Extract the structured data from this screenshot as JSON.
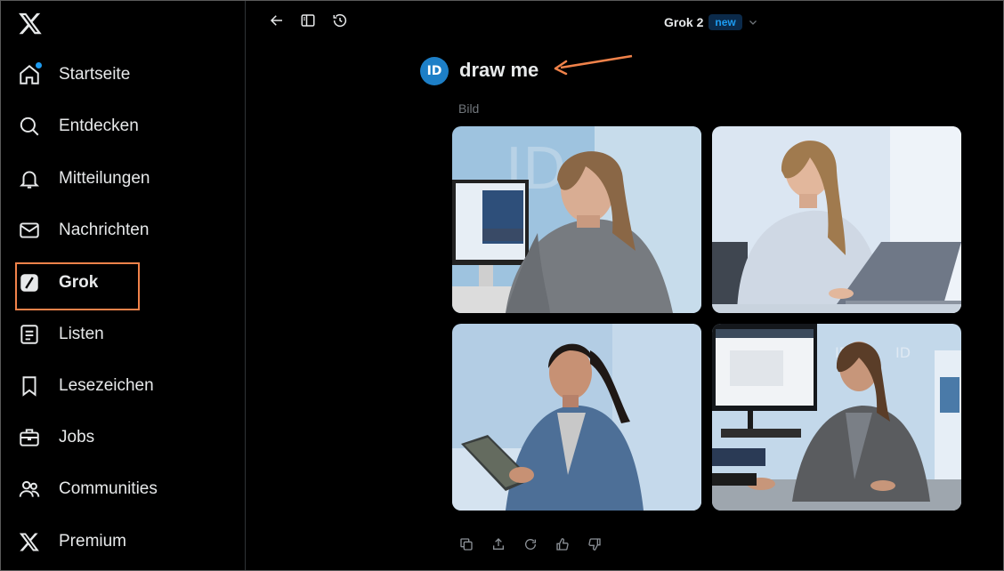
{
  "app": {
    "logo": "x-logo-icon"
  },
  "sidebar": {
    "items": [
      {
        "label": "Startseite",
        "icon": "home-icon",
        "has_dot": true
      },
      {
        "label": "Entdecken",
        "icon": "search-icon"
      },
      {
        "label": "Mitteilungen",
        "icon": "bell-icon"
      },
      {
        "label": "Nachrichten",
        "icon": "mail-icon"
      },
      {
        "label": "Grok",
        "icon": "grok-icon",
        "active": true
      },
      {
        "label": "Listen",
        "icon": "list-icon"
      },
      {
        "label": "Lesezeichen",
        "icon": "bookmark-icon"
      },
      {
        "label": "Jobs",
        "icon": "briefcase-icon"
      },
      {
        "label": "Communities",
        "icon": "communities-icon"
      },
      {
        "label": "Premium",
        "icon": "x-premium-icon"
      }
    ]
  },
  "topbar": {
    "back_icon": "arrow-left-icon",
    "sidebar_toggle_icon": "panel-icon",
    "history_icon": "history-icon",
    "model_name": "Grok 2",
    "new_badge": "new",
    "dropdown_icon": "chevron-down-icon"
  },
  "message": {
    "avatar_initials": "ID",
    "prompt": "draw me",
    "image_caption": "Bild"
  },
  "images": [
    {
      "alt": "Woman in grey sweater at computer monitor"
    },
    {
      "alt": "Woman in light sweater typing on laptop"
    },
    {
      "alt": "Woman in blue blazer holding tablet"
    },
    {
      "alt": "Woman in grey blazer at desk with monitor"
    }
  ],
  "actions": [
    {
      "icon": "copy-icon"
    },
    {
      "icon": "share-icon"
    },
    {
      "icon": "regenerate-icon"
    },
    {
      "icon": "thumbs-up-icon"
    },
    {
      "icon": "thumbs-down-icon"
    }
  ],
  "annotation_color": "#f0824a",
  "accent_color": "#1d9bf0"
}
